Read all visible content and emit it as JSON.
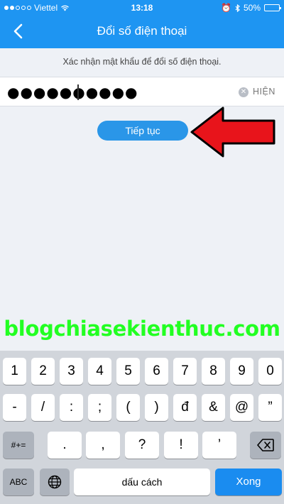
{
  "status_bar": {
    "carrier": "Viettel",
    "time": "13:18",
    "battery": "50%"
  },
  "nav": {
    "title": "Đổi số điện thoại",
    "back_icon": "chevron-left-icon"
  },
  "content": {
    "instruction": "Xác nhận mật khẩu để đổi số điện thoại.",
    "password_value": "●●●●●●●●●●",
    "show_label": "HIỆN",
    "continue_label": "Tiếp tục",
    "arrow_color": "#e8141b"
  },
  "watermark": "blogchiasekienthuc.com",
  "keyboard": {
    "row1": [
      "1",
      "2",
      "3",
      "4",
      "5",
      "6",
      "7",
      "8",
      "9",
      "0"
    ],
    "row2": [
      "-",
      "/",
      ":",
      ";",
      "(",
      ")",
      "đ",
      "&",
      "@",
      "”"
    ],
    "row3_left": "#+=",
    "row3": [
      ".",
      ",",
      "?",
      "!",
      "’"
    ],
    "row4_abc": "ABC",
    "row4_space": "dấu cách",
    "row4_done": "Xong"
  },
  "colors": {
    "header": "#1e95f2",
    "button": "#2a96e8",
    "watermark": "#22ff22",
    "done_key": "#1a8cf0"
  }
}
